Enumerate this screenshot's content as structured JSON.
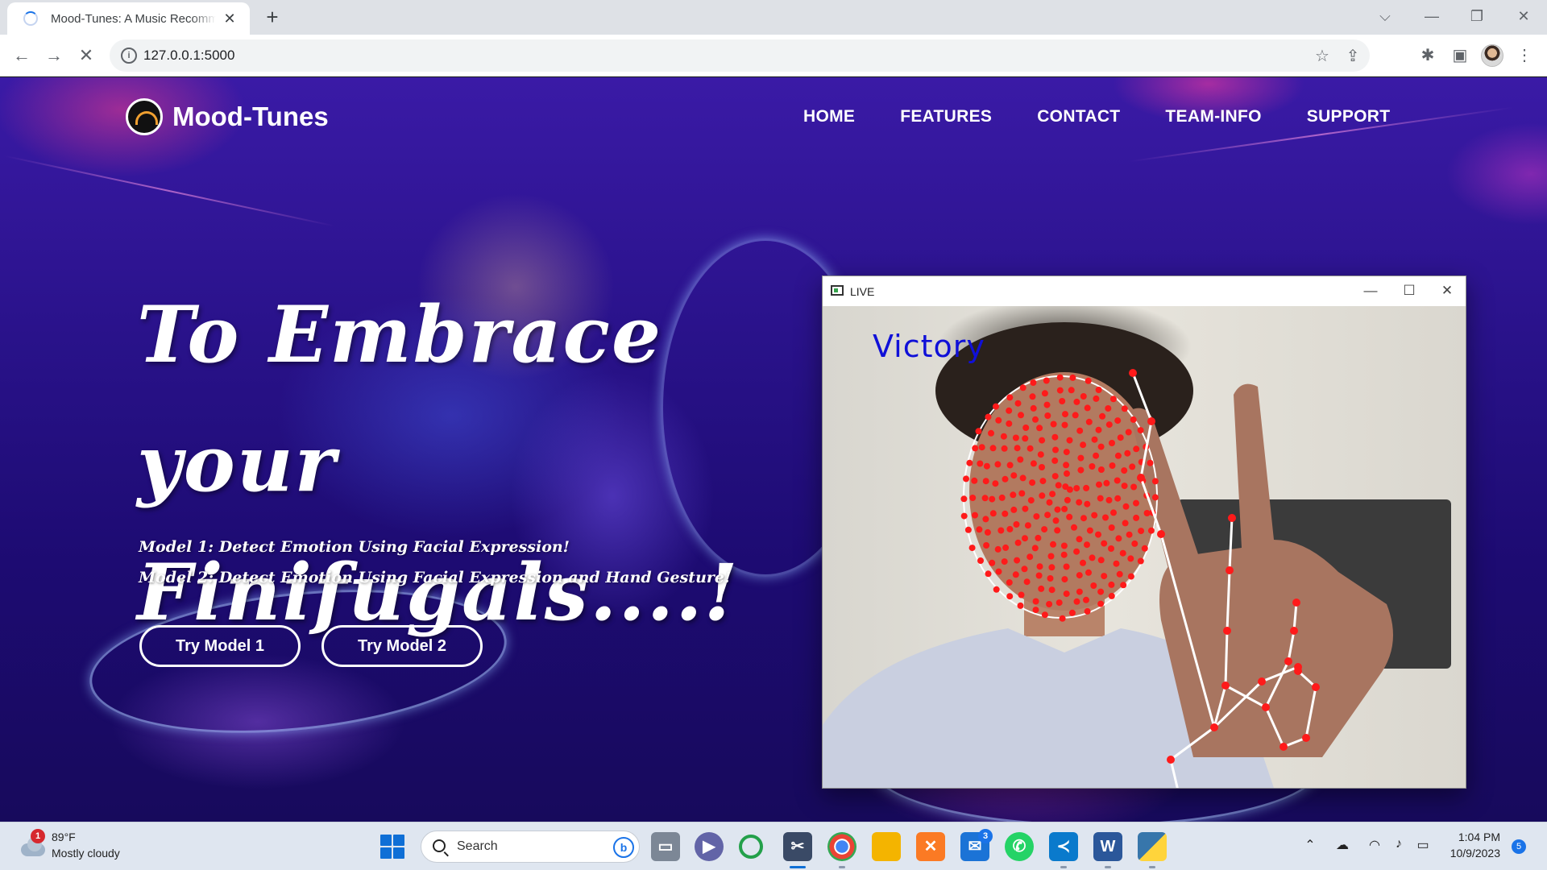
{
  "browser": {
    "tab_title": "Mood-Tunes: A Music Recommender",
    "tab_close": "✕",
    "new_tab": "+",
    "url": "127.0.0.1:5000",
    "win_controls": {
      "dropdown": "⌵",
      "minimize": "—",
      "restore": "❐",
      "close": "✕"
    },
    "nav": {
      "back": "←",
      "forward": "→",
      "stop": "✕"
    }
  },
  "site": {
    "brand": "Mood-Tunes",
    "nav_items": [
      "HOME",
      "FEATURES",
      "CONTACT",
      "TEAM-INFO",
      "SUPPORT"
    ],
    "hero_line1": "To Embrace your",
    "hero_line2": "Finifugals....!",
    "model1_text": "Model 1: Detect Emotion Using Facial Expression!",
    "model2_text": "Model 2: Detect Emotion Using Facial Expression and Hand Gesture!",
    "btn_model1": "Try Model 1",
    "btn_model2": "Try Model 2"
  },
  "live_window": {
    "title": "LIVE",
    "gesture_label": "Victory",
    "controls": {
      "minimize": "—",
      "maximize": "☐",
      "close": "✕"
    },
    "landmark_color": "#ff1a1a",
    "connector_color": "#ffffff"
  },
  "taskbar": {
    "weather_badge": "1",
    "temperature": "89°F",
    "condition": "Mostly cloudy",
    "search_placeholder": "Search",
    "bing_label": "b",
    "mail_badge": "3",
    "time": "1:04 PM",
    "date": "10/9/2023",
    "notifications": "5",
    "apps": [
      "file-explorer-icon",
      "teams-chat-icon",
      "loading-app-icon",
      "snipping-tool-icon",
      "chrome-icon",
      "folder-icon",
      "xampp-icon",
      "mail-icon",
      "whatsapp-icon",
      "vscode-icon",
      "word-icon",
      "python-icon"
    ]
  }
}
